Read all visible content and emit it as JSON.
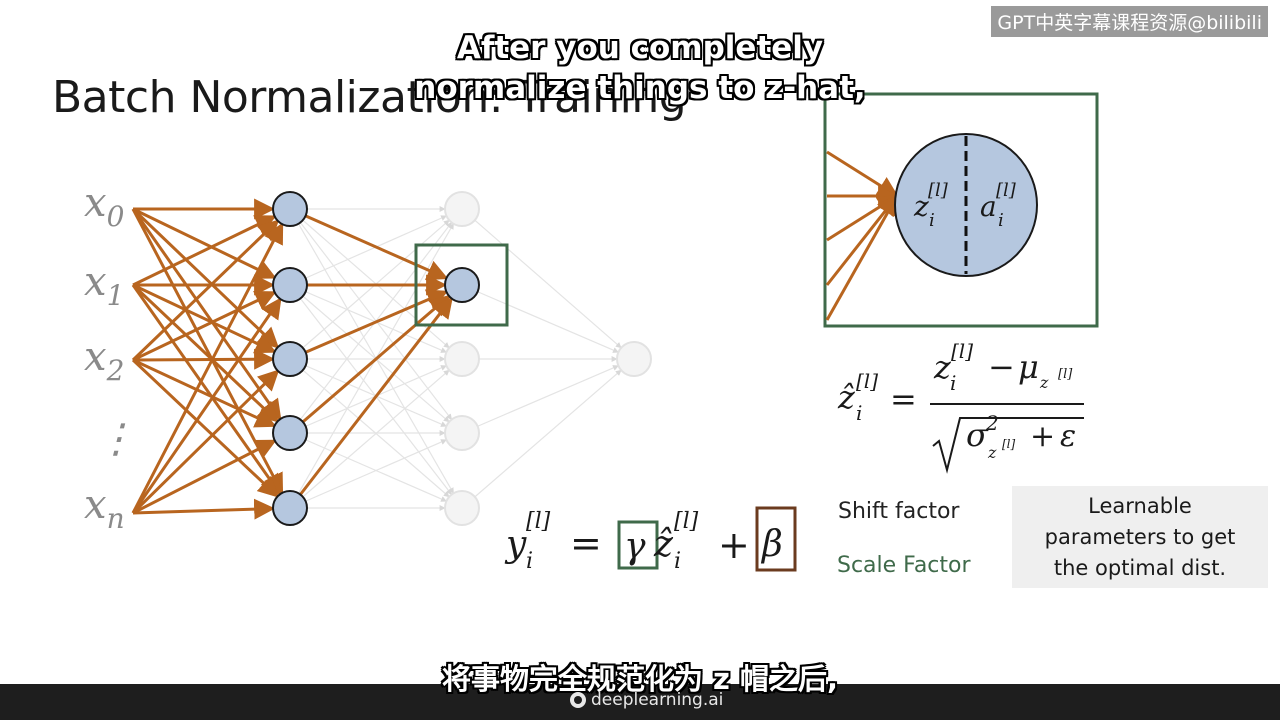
{
  "slide": {
    "title": "Batch Normalization: Training"
  },
  "subtitles": {
    "en_line1": "After you completely",
    "en_line2": "normalize things to z-hat,",
    "zh": "将事物完全规范化为 z 帽之后,"
  },
  "watermark": {
    "text": "GPT中英字幕课程资源@bilibili"
  },
  "network": {
    "inputs": [
      {
        "base": "x",
        "sub": "0"
      },
      {
        "base": "x",
        "sub": "1"
      },
      {
        "base": "x",
        "sub": "2"
      },
      {
        "base": "x",
        "sub": "n"
      }
    ],
    "dots": "⋮"
  },
  "zoom": {
    "z_label": "z",
    "a_label": "a",
    "sub": "i",
    "sup": "[l]"
  },
  "formulas": {
    "zhat_lhs_base": "ẑ",
    "zhat_lhs_sub": "i",
    "zhat_lhs_sup": "[l]",
    "eq": "=",
    "num_z": "z",
    "num_minus": "−",
    "num_mu": "μ",
    "den_sigma": "σ",
    "den_sq": "2",
    "den_plus": "+",
    "den_eps": "ε",
    "y_base": "y",
    "gamma": "γ",
    "plus": "+",
    "beta": "β"
  },
  "labels": {
    "shift": "Shift factor",
    "scale": "Scale Factor",
    "learnable": "Learnable parameters to get the optimal dist."
  },
  "colors": {
    "edge_orange": "#b8651f",
    "neuron_blue": "#b5c7df",
    "box_green": "#3f6a4a",
    "box_brown": "#6b3b1f",
    "faint": "#dcdcdc"
  },
  "brand": {
    "text": "deeplearning.ai"
  }
}
